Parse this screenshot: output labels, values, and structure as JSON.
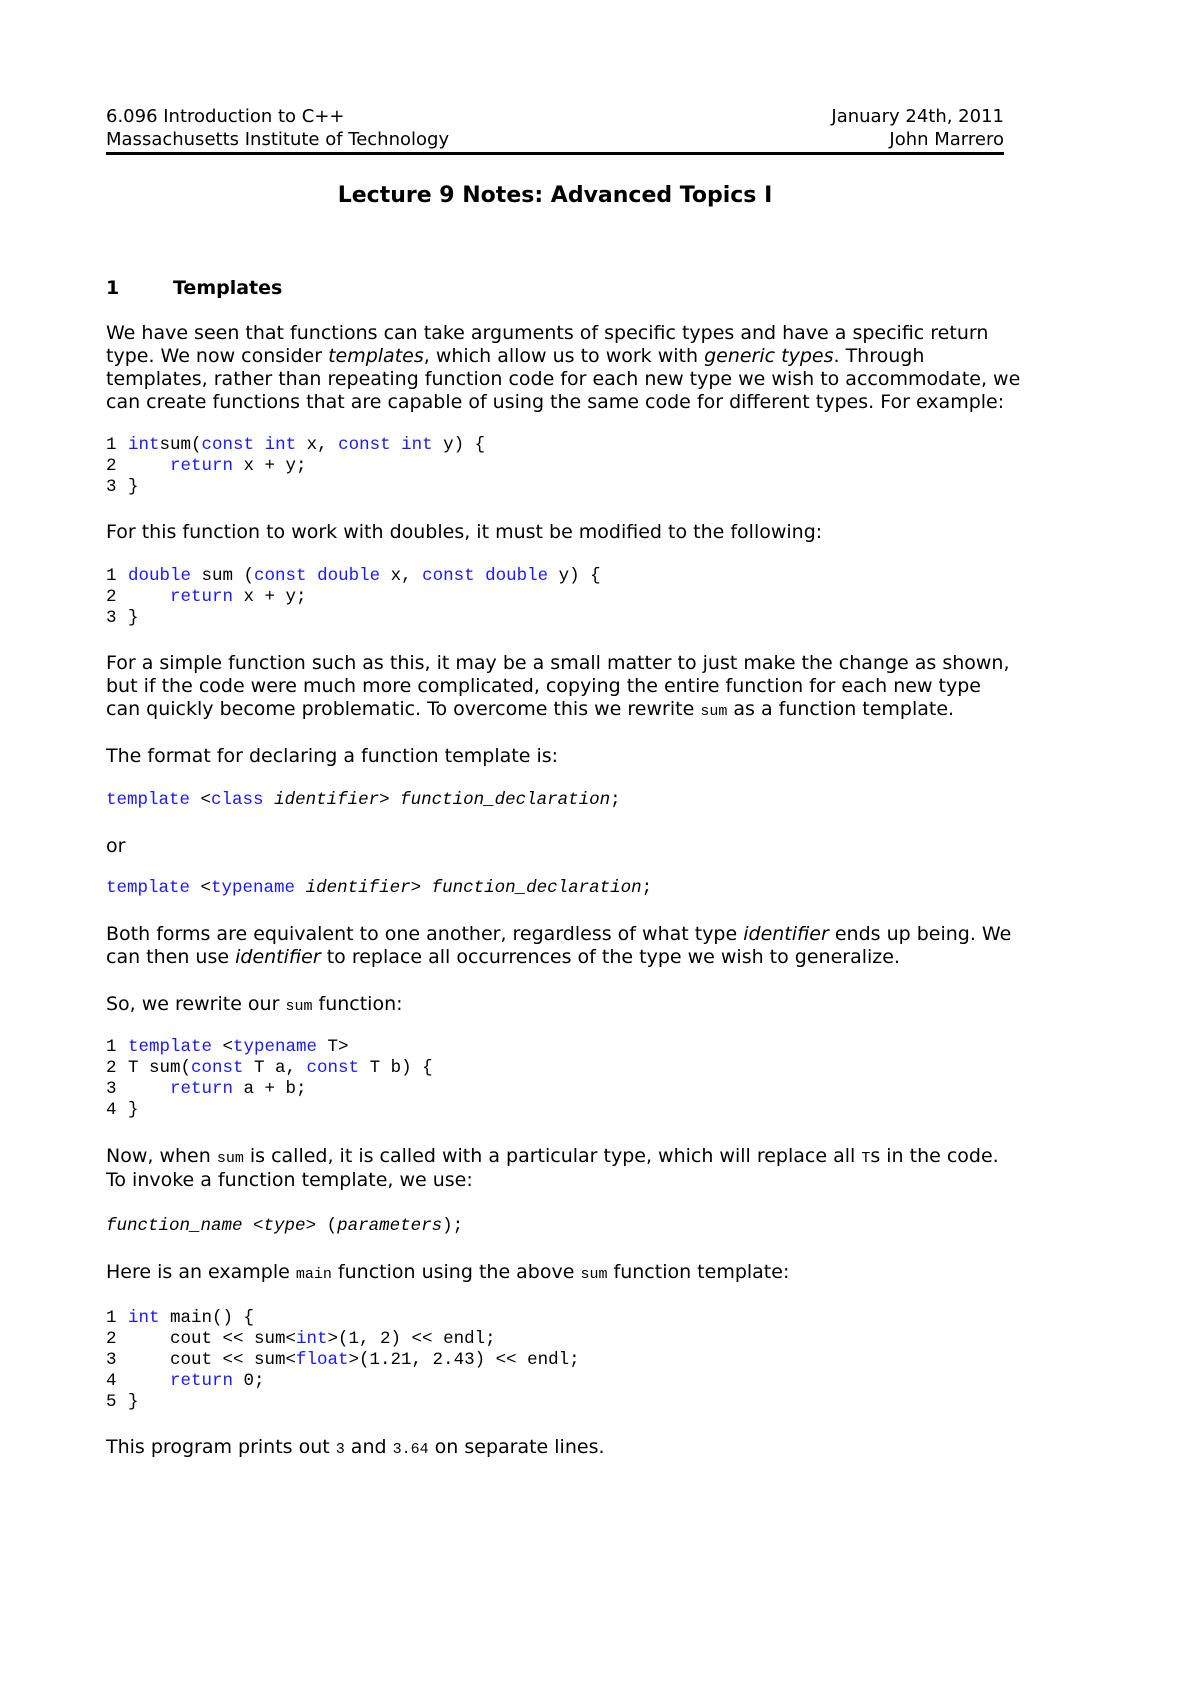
{
  "header": {
    "course": "6.096 Introduction to C++",
    "date": "January 24th, 2011",
    "institution": "Massachusetts Institute of Technology",
    "author": "John Marrero"
  },
  "title": "Lecture 9 Notes: Advanced Topics I",
  "section": {
    "number": "1",
    "title": "Templates"
  },
  "paragraphs": {
    "intro": [
      [
        "We have seen that functions can take arguments of specific types and have a specific return"
      ],
      [
        "type. We now consider ",
        "templates",
        ", which allow us to work with ",
        "generic types",
        ". Through"
      ],
      [
        "templates, rather than repeating function code for each new type we wish to accommodate, we"
      ],
      [
        "can create functions that are capable of using the same code for different types. For example:"
      ]
    ],
    "doubles": "For this function to work with doubles, it must be modified to the following:",
    "simple": [
      "For a simple function such as this, it may be a small matter to just make the change as shown,",
      "but if the code were much more complicated, copying the entire function for each new type",
      [
        "can quickly become problematic. To overcome this we rewrite ",
        "sum",
        " as a function template."
      ]
    ],
    "format": "The format for declaring a function template is:",
    "or": "or",
    "both": [
      [
        "Both forms are equivalent to one another, regardless of what type ",
        "identifier",
        " ends up being. We"
      ],
      [
        "can then use ",
        "identifier",
        " to replace all occurrences of the type we wish to generalize."
      ]
    ],
    "rewrite": [
      "So, we rewrite our ",
      "sum",
      " function:"
    ],
    "now": [
      [
        "Now, when ",
        "sum",
        " is called, it is called with a particular type, which will replace all ",
        "T",
        "s in the code."
      ],
      [
        "To invoke a function template, we use:"
      ]
    ],
    "example": [
      "Here is an example ",
      "main",
      " function using the above ",
      "sum",
      " function template:"
    ],
    "prints": [
      "This program prints out ",
      "3",
      " and ",
      "3.64",
      " on separate lines."
    ]
  },
  "code": {
    "sum_int": [
      {
        "n": "1",
        "parts": [
          [
            "kw",
            "int"
          ],
          [
            "",
            "sum("
          ],
          [
            "kw",
            "const"
          ],
          [
            "",
            " "
          ],
          [
            "kw",
            "int"
          ],
          [
            "",
            " x, "
          ],
          [
            "kw",
            "const"
          ],
          [
            "",
            " "
          ],
          [
            "kw",
            "int"
          ],
          [
            "",
            " y) {"
          ]
        ]
      },
      {
        "n": "2",
        "parts": [
          [
            "",
            "    "
          ],
          [
            "kw",
            "return"
          ],
          [
            "",
            " x + y;"
          ]
        ]
      },
      {
        "n": "3",
        "parts": [
          [
            "",
            "}"
          ]
        ]
      }
    ],
    "sum_double": [
      {
        "n": "1",
        "parts": [
          [
            "kw",
            "double"
          ],
          [
            "",
            " sum ("
          ],
          [
            "kw",
            "const"
          ],
          [
            "",
            " "
          ],
          [
            "kw",
            "double"
          ],
          [
            "",
            " x, "
          ],
          [
            "kw",
            "const"
          ],
          [
            "",
            " "
          ],
          [
            "kw",
            "double"
          ],
          [
            "",
            " y) {"
          ]
        ]
      },
      {
        "n": "2",
        "parts": [
          [
            "",
            "    "
          ],
          [
            "kw",
            "return"
          ],
          [
            "",
            " x + y;"
          ]
        ]
      },
      {
        "n": "3",
        "parts": [
          [
            "",
            "}"
          ]
        ]
      }
    ],
    "format_class": [
      [
        "kw",
        "template"
      ],
      [
        "",
        " <"
      ],
      [
        "kw",
        "class"
      ],
      [
        "",
        " "
      ],
      [
        "it",
        "identifier"
      ],
      [
        "",
        "> "
      ],
      [
        "it",
        "function_declaration"
      ],
      [
        "",
        ";"
      ]
    ],
    "format_typename": [
      [
        "kw",
        "template"
      ],
      [
        "",
        " <"
      ],
      [
        "kw",
        "typename"
      ],
      [
        "",
        " "
      ],
      [
        "it",
        "identifier"
      ],
      [
        "",
        "> "
      ],
      [
        "it",
        "function_declaration"
      ],
      [
        "",
        ";"
      ]
    ],
    "sum_template": [
      {
        "n": "1",
        "parts": [
          [
            "kw",
            "template"
          ],
          [
            "",
            " <"
          ],
          [
            "kw",
            "typename"
          ],
          [
            "",
            " T>"
          ]
        ]
      },
      {
        "n": "2",
        "parts": [
          [
            "",
            "T sum("
          ],
          [
            "kw",
            "const"
          ],
          [
            "",
            " T a, "
          ],
          [
            "kw",
            "const"
          ],
          [
            "",
            " T b) {"
          ]
        ]
      },
      {
        "n": "3",
        "parts": [
          [
            "",
            "    "
          ],
          [
            "kw",
            "return"
          ],
          [
            "",
            " a + b;"
          ]
        ]
      },
      {
        "n": "4",
        "parts": [
          [
            "",
            "}"
          ]
        ]
      }
    ],
    "invoke": [
      [
        "it",
        "function_name"
      ],
      [
        "",
        " <"
      ],
      [
        "it",
        "type"
      ],
      [
        "",
        "> ("
      ],
      [
        "it",
        "parameters"
      ],
      [
        "",
        ");"
      ]
    ],
    "main_example": [
      {
        "n": "1",
        "parts": [
          [
            "kw",
            "int"
          ],
          [
            "",
            " main() {"
          ]
        ]
      },
      {
        "n": "2",
        "parts": [
          [
            "",
            "    cout << sum<"
          ],
          [
            "kw",
            "int"
          ],
          [
            "",
            ">(1, 2) << endl;"
          ]
        ]
      },
      {
        "n": "3",
        "parts": [
          [
            "",
            "    cout << sum<"
          ],
          [
            "kw",
            "float"
          ],
          [
            "",
            ">(1.21, 2.43) << endl;"
          ]
        ]
      },
      {
        "n": "4",
        "parts": [
          [
            "",
            "    "
          ],
          [
            "kw",
            "return"
          ],
          [
            "",
            " 0;"
          ]
        ]
      },
      {
        "n": "5",
        "parts": [
          [
            "",
            "}"
          ]
        ]
      }
    ]
  },
  "colors": {
    "keyword": "#1a1aff",
    "text": "#000000",
    "rule": "#000000"
  }
}
